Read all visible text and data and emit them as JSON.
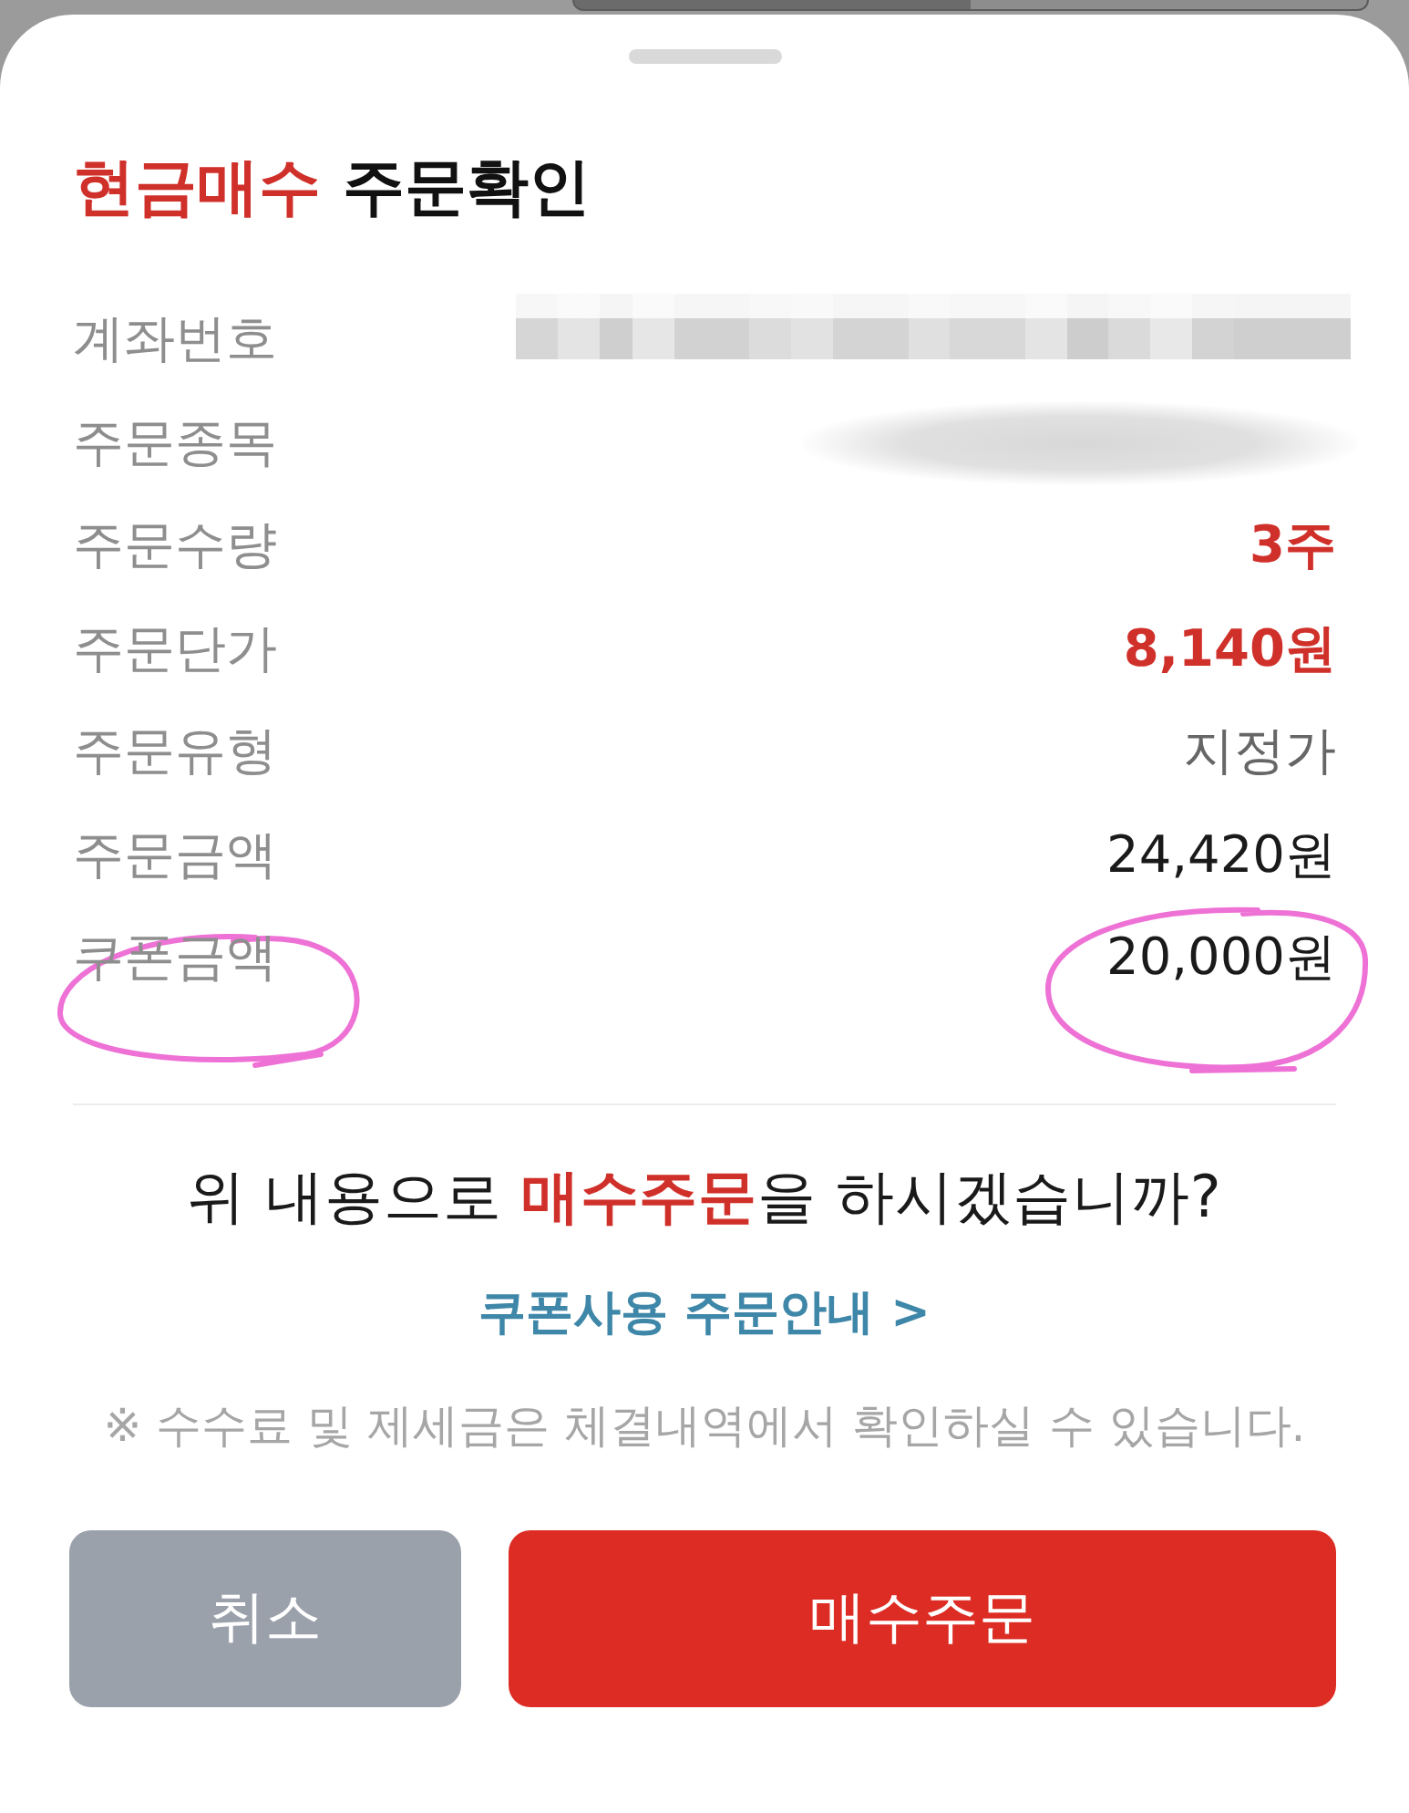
{
  "title": "**현금매수** 주문확인",
  "rows": [
    {
      "label": "계좌번호",
      "kind": "pixelated",
      "circled": false
    },
    {
      "label": "주문종목",
      "kind": "blurred",
      "circled": false
    },
    {
      "label": "주문수량",
      "kind": "accent",
      "value": "3주",
      "circled": false
    },
    {
      "label": "주문단가",
      "kind": "accent",
      "value": "8,140원",
      "circled": false
    },
    {
      "label": "주문유형",
      "kind": "muted",
      "value": "지정가",
      "circled": false
    },
    {
      "label": "주문금액",
      "kind": "plain",
      "value": "24,420원",
      "circled": false
    },
    {
      "label": "쿠폰금액",
      "kind": "plain",
      "value": "20,000원",
      "circled": true
    }
  ],
  "question": "위 내용으로 **매수주문**을 하시겠습니까?",
  "guide_link": "쿠폰사용 주문안내 >",
  "note": "※ 수수료 및 제세금은 체결내역에서 확인하실 수 있습니다.",
  "buttons": [
    {
      "label": "취소",
      "kind": "secondary"
    },
    {
      "label": "매수주문",
      "kind": "primary"
    }
  ]
}
